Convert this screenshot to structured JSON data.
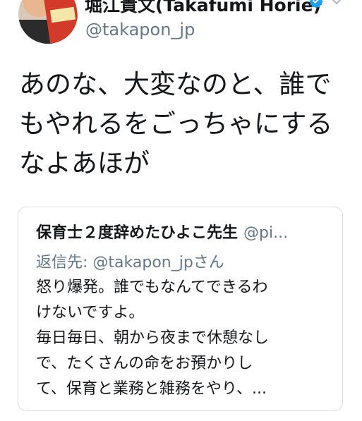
{
  "tweet": {
    "display_name": "堀江貴文(Takafumi Horie)",
    "handle": "@takapon_jp",
    "text_lines": [
      "あのな、大変なのと、誰で",
      "もやれるをごっちゃにする",
      "なよあほが"
    ]
  },
  "quote": {
    "name": "保育士２度辞めたひよこ先生",
    "handle": "@pi...",
    "reply_to": "返信先: @takapon_jpさん",
    "body_lines": [
      "怒り爆発。誰でもなんてできるわ",
      "けないですよ。",
      "毎日毎日、朝から夜まで休憩なし",
      "で、たくさんの命をお預かりし",
      "て、保育と業務と雑務をやり、..."
    ]
  },
  "icons": {
    "verified": "verified-badge-icon",
    "chevron": "chevron-down-icon",
    "avatar": "avatar"
  },
  "colors": {
    "verified_blue": "#1da1f2",
    "muted_text": "#657786",
    "primary_text": "#14171a",
    "card_border": "#d9dee2"
  }
}
